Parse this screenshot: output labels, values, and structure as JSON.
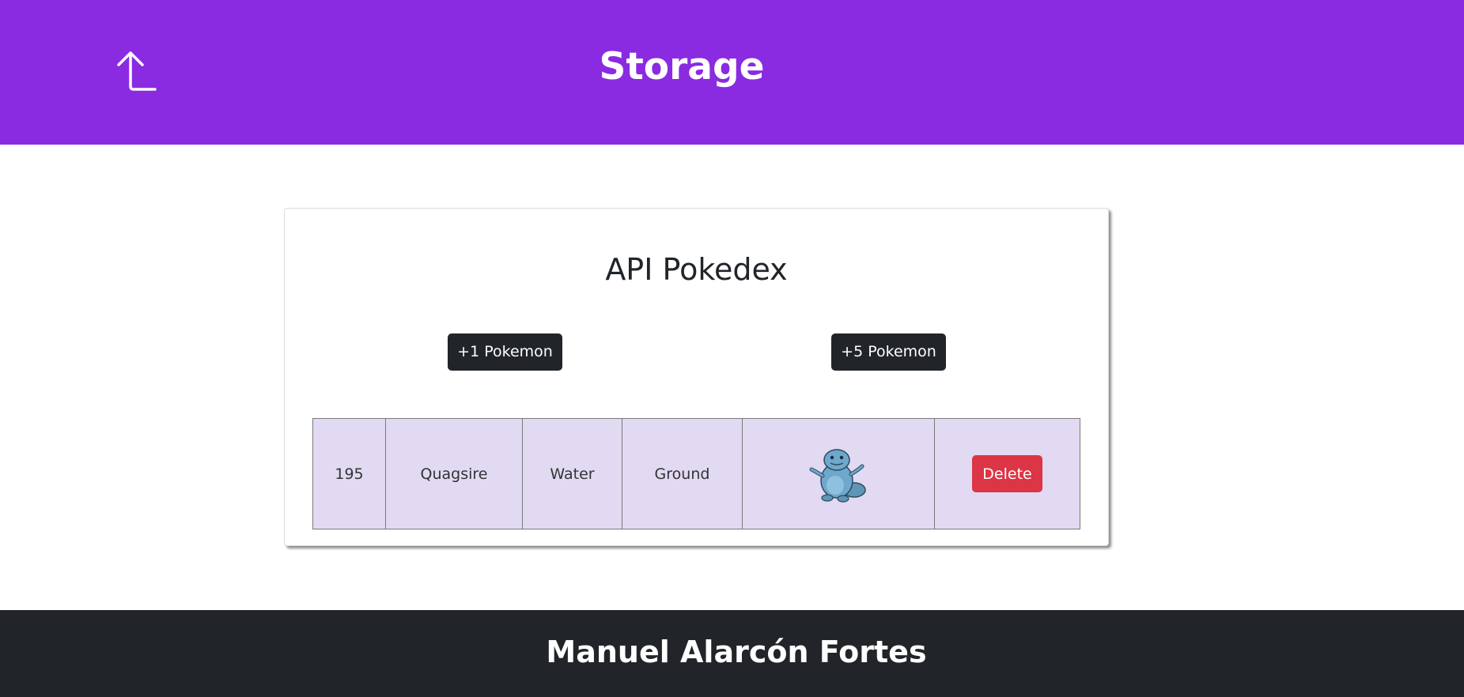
{
  "header": {
    "title": "Storage",
    "back_icon": "arrow-up-left-icon",
    "background_color": "#8a2be2"
  },
  "card": {
    "title": "API Pokedex",
    "buttons": {
      "add_one_label": "+1 Pokemon",
      "add_five_label": "+5 Pokemon"
    }
  },
  "table": {
    "rows": [
      {
        "id": "195",
        "name": "Quagsire",
        "type1": "Water",
        "type2": "Ground",
        "sprite_icon": "quagsire-sprite-icon",
        "delete_label": "Delete"
      }
    ],
    "row_background": "#e2d9f3"
  },
  "footer": {
    "text": "Manuel Alarcón Fortes",
    "background_color": "#212529"
  },
  "colors": {
    "danger": "#dc3545",
    "dark": "#212529"
  }
}
